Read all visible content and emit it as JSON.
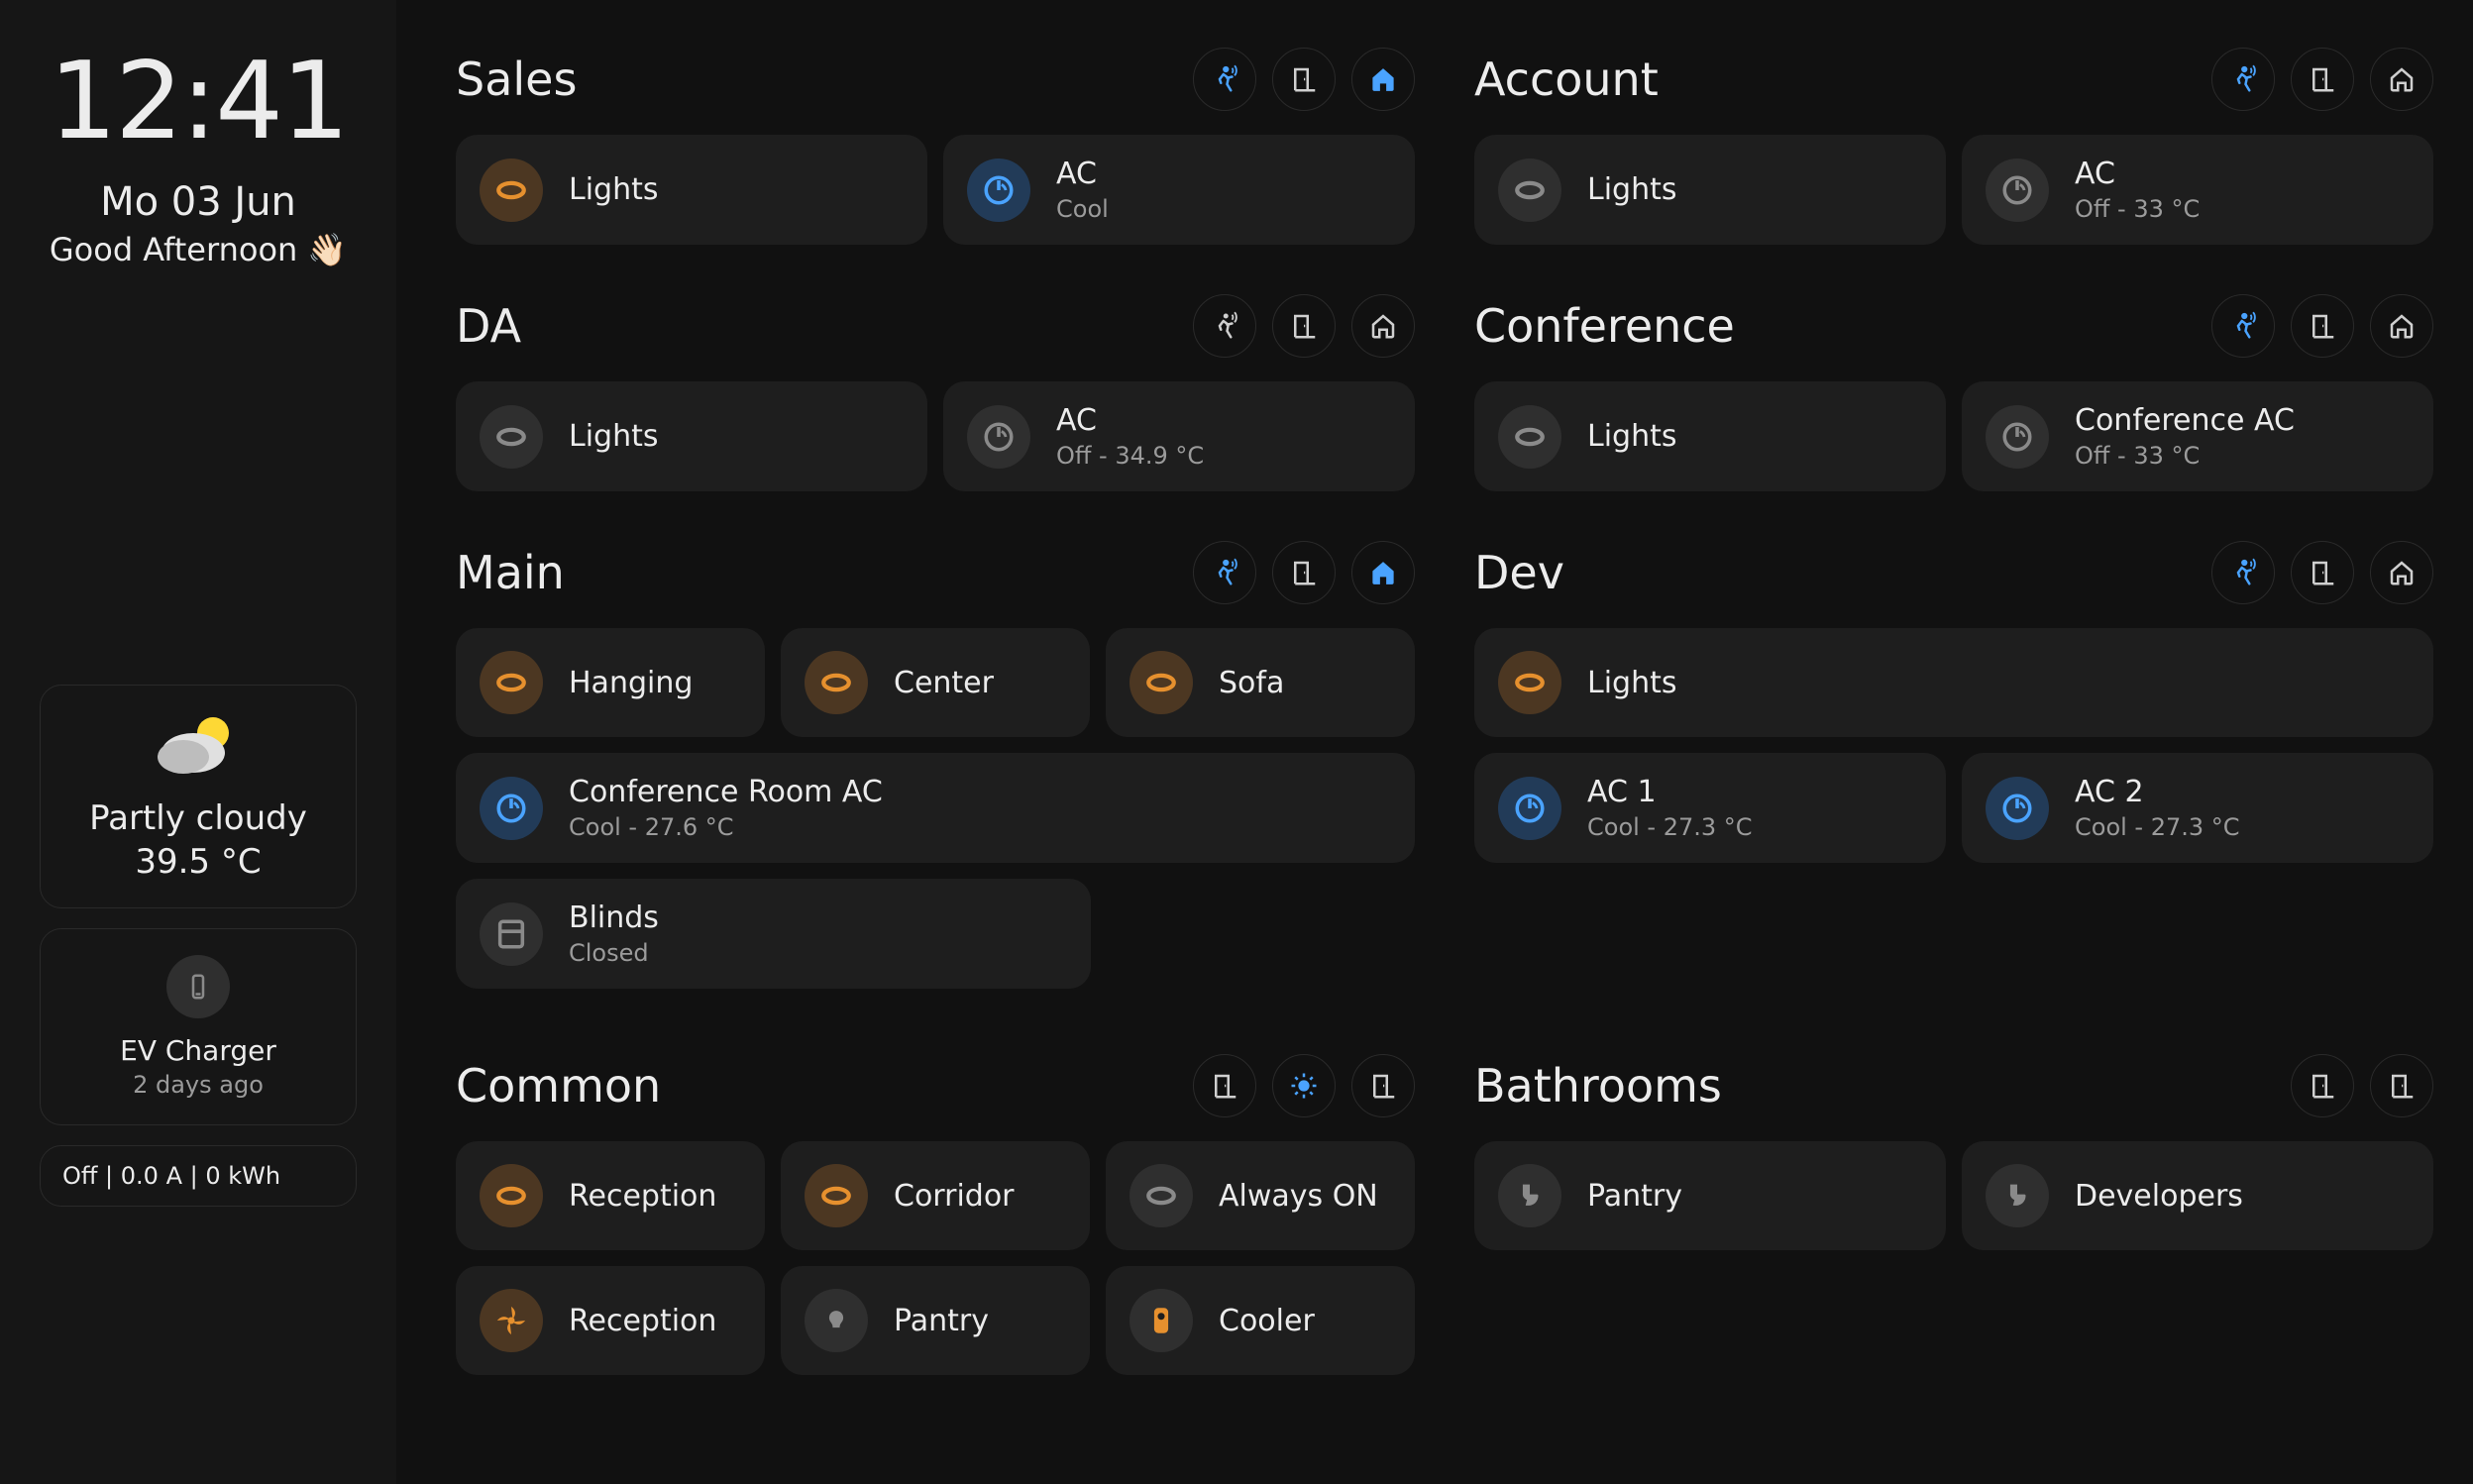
{
  "sidebar": {
    "clock": "12:41",
    "date": "Mo 03 Jun",
    "greeting": "Good Afternoon",
    "greeting_emoji": "👋🏻",
    "weather": {
      "condition": "Partly cloudy",
      "temp": "39.5 °C"
    },
    "ev": {
      "title": "EV Charger",
      "updated": "2 days ago",
      "status": "Off | 0.0 A | 0 kWh"
    }
  },
  "rooms": [
    {
      "id": "sales",
      "title": "Sales",
      "actions": [
        "motion-active",
        "door",
        "home-active"
      ],
      "cols": 2,
      "cards": [
        {
          "name": "sales-lights",
          "icon": "ring",
          "tone": "orange",
          "title": "Lights"
        },
        {
          "name": "sales-ac",
          "icon": "thermo",
          "tone": "blue",
          "title": "AC",
          "sub": "Cool"
        }
      ]
    },
    {
      "id": "account",
      "title": "Account",
      "actions": [
        "motion-active",
        "door",
        "home"
      ],
      "cols": 2,
      "cards": [
        {
          "name": "account-lights",
          "icon": "ring",
          "tone": "grey",
          "title": "Lights"
        },
        {
          "name": "account-ac",
          "icon": "thermo",
          "tone": "grey",
          "title": "AC",
          "sub": "Off - 33 °C"
        }
      ]
    },
    {
      "id": "da",
      "title": "DA",
      "actions": [
        "motion",
        "door",
        "home"
      ],
      "cols": 2,
      "cards": [
        {
          "name": "da-lights",
          "icon": "ring",
          "tone": "grey",
          "title": "Lights"
        },
        {
          "name": "da-ac",
          "icon": "thermo",
          "tone": "grey",
          "title": "AC",
          "sub": "Off - 34.9 °C"
        }
      ]
    },
    {
      "id": "conference",
      "title": "Conference",
      "actions": [
        "motion-active",
        "door",
        "home"
      ],
      "cols": 2,
      "cards": [
        {
          "name": "conf-lights",
          "icon": "ring",
          "tone": "grey",
          "title": "Lights"
        },
        {
          "name": "conf-ac",
          "icon": "thermo",
          "tone": "grey",
          "title": "Conference AC",
          "sub": "Off - 33 °C"
        }
      ]
    },
    {
      "id": "main",
      "title": "Main",
      "actions": [
        "motion-active",
        "door",
        "home-active"
      ],
      "cols": 3,
      "rows": [
        [
          {
            "name": "main-hanging",
            "icon": "ring",
            "tone": "orange",
            "title": "Hanging"
          },
          {
            "name": "main-center",
            "icon": "ring",
            "tone": "orange",
            "title": "Center"
          },
          {
            "name": "main-sofa",
            "icon": "ring",
            "tone": "orange",
            "title": "Sofa"
          }
        ],
        [
          {
            "name": "main-confac",
            "icon": "thermo",
            "tone": "blue",
            "title": "Conference Room AC",
            "sub": "Cool - 27.6 °C",
            "span": 2
          },
          {
            "name": "main-blinds",
            "icon": "blinds",
            "tone": "grey",
            "title": "Blinds",
            "sub": "Closed"
          }
        ]
      ]
    },
    {
      "id": "dev",
      "title": "Dev",
      "actions": [
        "motion-active",
        "door",
        "home"
      ],
      "rows": [
        [
          {
            "name": "dev-lights",
            "icon": "ring",
            "tone": "orange",
            "title": "Lights",
            "full": true
          }
        ],
        [
          {
            "name": "dev-ac1",
            "icon": "thermo",
            "tone": "blue",
            "title": "AC 1",
            "sub": "Cool - 27.3 °C"
          },
          {
            "name": "dev-ac2",
            "icon": "thermo",
            "tone": "blue",
            "title": "AC 2",
            "sub": "Cool - 27.3 °C"
          }
        ]
      ]
    },
    {
      "id": "common",
      "title": "Common",
      "actions": [
        "door",
        "bright-active",
        "door"
      ],
      "cols": 3,
      "rows": [
        [
          {
            "name": "common-reception",
            "icon": "ring",
            "tone": "orange",
            "title": "Reception"
          },
          {
            "name": "common-corridor",
            "icon": "ring",
            "tone": "orange",
            "title": "Corridor"
          },
          {
            "name": "common-always",
            "icon": "ring",
            "tone": "grey",
            "title": "Always ON"
          }
        ],
        [
          {
            "name": "common-reception-fan",
            "icon": "fan",
            "tone": "orange",
            "title": "Reception"
          },
          {
            "name": "common-pantry",
            "icon": "bulb",
            "tone": "grey",
            "title": "Pantry"
          },
          {
            "name": "common-cooler",
            "icon": "cooler",
            "tone": "orange-solo",
            "title": "Cooler"
          }
        ]
      ]
    },
    {
      "id": "bathrooms",
      "title": "Bathrooms",
      "actions": [
        "door",
        "door"
      ],
      "cols": 2,
      "cards": [
        {
          "name": "bath-pantry",
          "icon": "toilet",
          "tone": "grey",
          "title": "Pantry"
        },
        {
          "name": "bath-dev",
          "icon": "toilet",
          "tone": "grey",
          "title": "Developers"
        }
      ]
    }
  ]
}
